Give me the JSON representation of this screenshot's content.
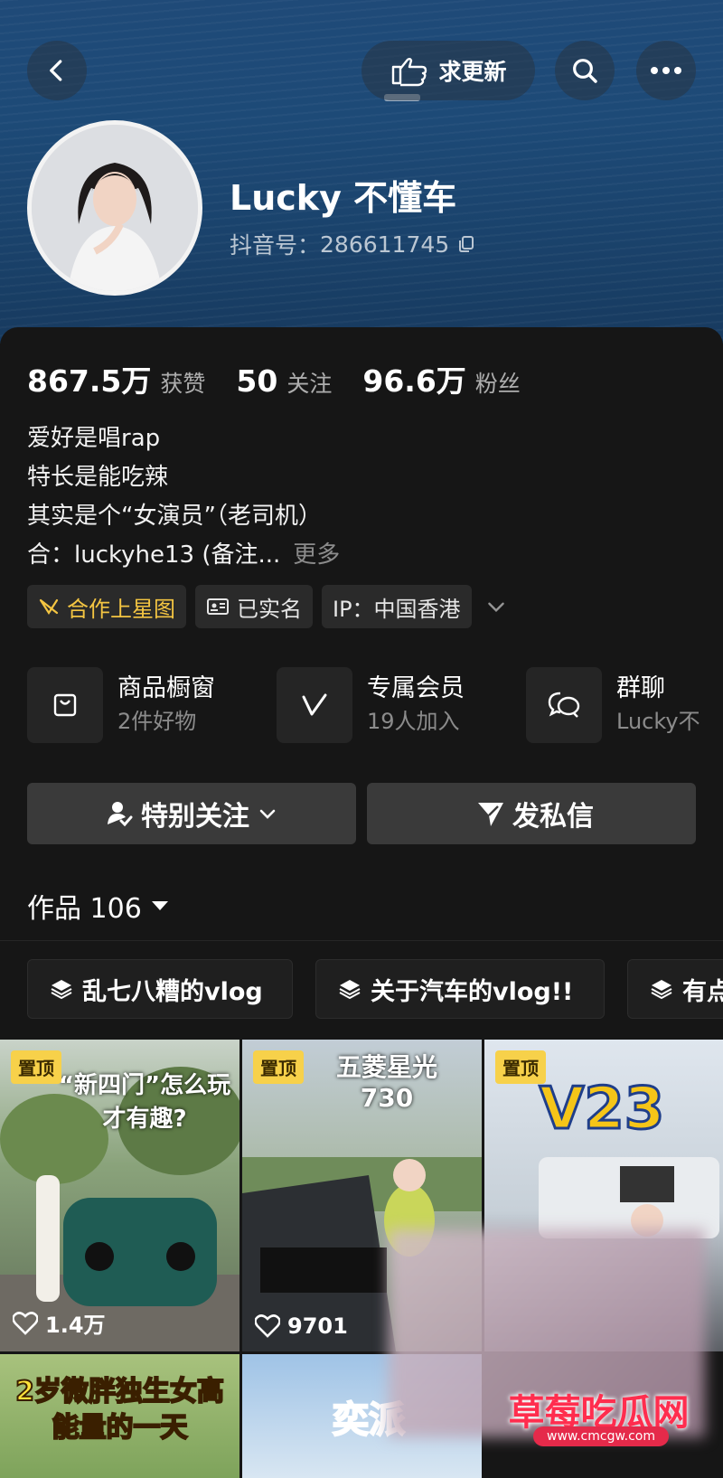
{
  "header": {
    "request_update_label": "求更新"
  },
  "profile": {
    "name": "Lucky 不懂车",
    "douyin_id_label": "抖音号：",
    "douyin_id": "286611745"
  },
  "stats": [
    {
      "num": "867.5万",
      "label": "获赞"
    },
    {
      "num": "50",
      "label": "关注"
    },
    {
      "num": "96.6万",
      "label": "粉丝"
    }
  ],
  "bio": {
    "lines": [
      "爱好是唱rap",
      "特长是能吃辣",
      "其实是个“女演员”（老司机）",
      "合：luckyhe13 (备注..."
    ],
    "more_label": "更多"
  },
  "tags": [
    {
      "label": "合作上星图"
    },
    {
      "label": "已实名"
    },
    {
      "label": "IP：中国香港"
    }
  ],
  "services": [
    {
      "title": "商品橱窗",
      "sub": "2件好物"
    },
    {
      "title": "专属会员",
      "sub": "19人加入"
    },
    {
      "title": "群聊",
      "sub": "Lucky不"
    }
  ],
  "actions": {
    "follow_label": "特别关注",
    "message_label": "发私信"
  },
  "works": {
    "label": "作品 106"
  },
  "collections": [
    {
      "label": "乱七八糟的vlog"
    },
    {
      "label": "关于汽车的vlog!!"
    },
    {
      "label": "有点"
    }
  ],
  "videos": [
    {
      "pinned_label": "置顶",
      "overlay_text": "“新四门”怎么玩才有趣?",
      "likes": "1.4万"
    },
    {
      "pinned_label": "置顶",
      "overlay_text": "五菱星光730",
      "likes": "9701"
    },
    {
      "pinned_label": "置顶",
      "overlay_text": "V23",
      "likes": ""
    },
    {
      "overlay_text": "2岁微胖独生女高能量的一天"
    },
    {
      "overlay_text": "奕派"
    }
  ],
  "watermark": {
    "title": "草莓吃瓜网",
    "url": "www.cmcgw.com"
  },
  "colors": {
    "accent_gold": "#f4c542",
    "header_blue": "#1d4a77",
    "background": "#161616"
  }
}
